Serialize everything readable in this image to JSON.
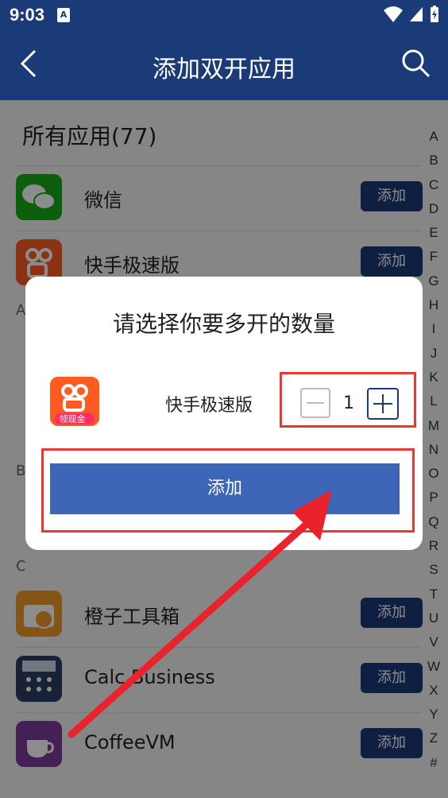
{
  "status": {
    "time": "9:03",
    "notif_glyph": "A"
  },
  "appbar": {
    "title": "添加双开应用",
    "back_icon": "back-icon",
    "search_icon": "search-icon"
  },
  "list": {
    "section_title": "所有应用(77)",
    "add_label": "添加",
    "apps_top": [
      {
        "name": "微信",
        "icon": "wechat-icon",
        "color": "#1aad19"
      },
      {
        "name": "快手极速版",
        "icon": "kuaishou-icon",
        "color": "#ff5a1f"
      }
    ],
    "letters": {
      "a": "A",
      "b": "B",
      "c": "C"
    },
    "apps_c": [
      {
        "name": "橙子工具箱",
        "icon": "orange-toolbox-icon",
        "color": "#f39a2b"
      },
      {
        "name": "Calc Business",
        "icon": "calculator-icon",
        "color": "#2d3e63"
      },
      {
        "name": "CoffeeVM",
        "icon": "coffeevm-icon",
        "color": "#7a3d99"
      }
    ]
  },
  "index_letters": [
    "A",
    "B",
    "C",
    "D",
    "E",
    "F",
    "G",
    "H",
    "I",
    "J",
    "K",
    "L",
    "M",
    "N",
    "O",
    "P",
    "Q",
    "R",
    "S",
    "T",
    "U",
    "V",
    "W",
    "X",
    "Y",
    "Z",
    "#"
  ],
  "dialog": {
    "title": "请选择你要多开的数量",
    "app_name": "快手极速版",
    "icon_badge": "领现金",
    "quantity": "1",
    "add_label": "添加"
  },
  "colors": {
    "primary": "#1b3a78",
    "dialog_button": "#3d66b8",
    "highlight": "#e53935"
  }
}
